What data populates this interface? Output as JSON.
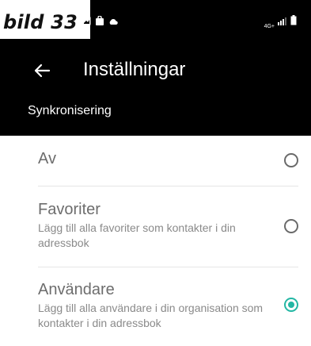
{
  "caption": "bild 33",
  "status_bar": {
    "network_label": "4G+"
  },
  "app_bar": {
    "title": "Inställningar"
  },
  "section": {
    "title": "Synkronisering"
  },
  "options": [
    {
      "title": "Av",
      "description": "",
      "selected": false
    },
    {
      "title": "Favoriter",
      "description": "Lägg till alla favoriter som kontakter i din adressbok",
      "selected": false
    },
    {
      "title": "Användare",
      "description": "Lägg till alla användare i din organisation som kontakter i din adressbok",
      "selected": true
    }
  ],
  "colors": {
    "header_bg": "#000000",
    "accent": "#23b7a4"
  }
}
